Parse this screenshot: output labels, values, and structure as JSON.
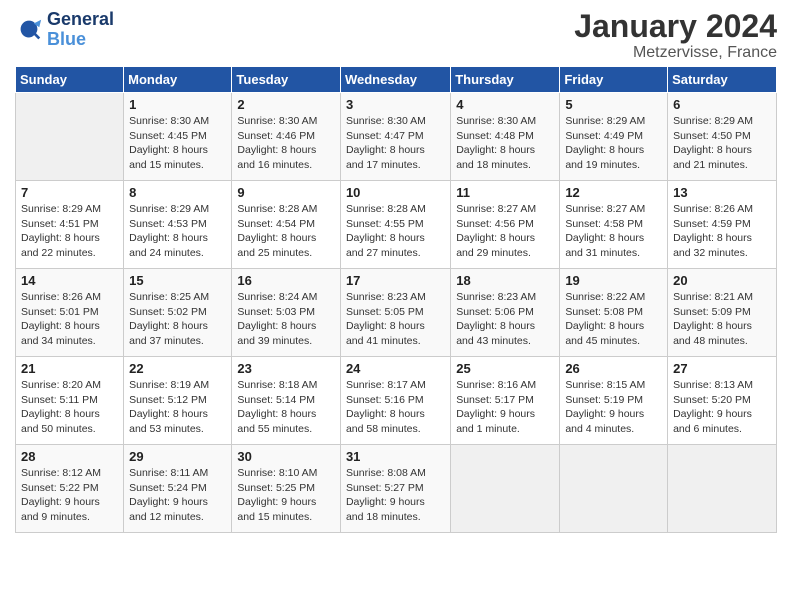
{
  "logo": {
    "line1": "General",
    "line2": "Blue"
  },
  "title": "January 2024",
  "location": "Metzervisse, France",
  "days_of_week": [
    "Sunday",
    "Monday",
    "Tuesday",
    "Wednesday",
    "Thursday",
    "Friday",
    "Saturday"
  ],
  "weeks": [
    [
      {
        "day": "",
        "info": ""
      },
      {
        "day": "1",
        "info": "Sunrise: 8:30 AM\nSunset: 4:45 PM\nDaylight: 8 hours\nand 15 minutes."
      },
      {
        "day": "2",
        "info": "Sunrise: 8:30 AM\nSunset: 4:46 PM\nDaylight: 8 hours\nand 16 minutes."
      },
      {
        "day": "3",
        "info": "Sunrise: 8:30 AM\nSunset: 4:47 PM\nDaylight: 8 hours\nand 17 minutes."
      },
      {
        "day": "4",
        "info": "Sunrise: 8:30 AM\nSunset: 4:48 PM\nDaylight: 8 hours\nand 18 minutes."
      },
      {
        "day": "5",
        "info": "Sunrise: 8:29 AM\nSunset: 4:49 PM\nDaylight: 8 hours\nand 19 minutes."
      },
      {
        "day": "6",
        "info": "Sunrise: 8:29 AM\nSunset: 4:50 PM\nDaylight: 8 hours\nand 21 minutes."
      }
    ],
    [
      {
        "day": "7",
        "info": ""
      },
      {
        "day": "8",
        "info": "Sunrise: 8:29 AM\nSunset: 4:53 PM\nDaylight: 8 hours\nand 24 minutes."
      },
      {
        "day": "9",
        "info": "Sunrise: 8:28 AM\nSunset: 4:54 PM\nDaylight: 8 hours\nand 25 minutes."
      },
      {
        "day": "10",
        "info": "Sunrise: 8:28 AM\nSunset: 4:55 PM\nDaylight: 8 hours\nand 27 minutes."
      },
      {
        "day": "11",
        "info": "Sunrise: 8:27 AM\nSunset: 4:56 PM\nDaylight: 8 hours\nand 29 minutes."
      },
      {
        "day": "12",
        "info": "Sunrise: 8:27 AM\nSunset: 4:58 PM\nDaylight: 8 hours\nand 31 minutes."
      },
      {
        "day": "13",
        "info": "Sunrise: 8:26 AM\nSunset: 4:59 PM\nDaylight: 8 hours\nand 32 minutes."
      }
    ],
    [
      {
        "day": "14",
        "info": ""
      },
      {
        "day": "15",
        "info": "Sunrise: 8:25 AM\nSunset: 5:02 PM\nDaylight: 8 hours\nand 37 minutes."
      },
      {
        "day": "16",
        "info": "Sunrise: 8:24 AM\nSunset: 5:03 PM\nDaylight: 8 hours\nand 39 minutes."
      },
      {
        "day": "17",
        "info": "Sunrise: 8:23 AM\nSunset: 5:05 PM\nDaylight: 8 hours\nand 41 minutes."
      },
      {
        "day": "18",
        "info": "Sunrise: 8:23 AM\nSunset: 5:06 PM\nDaylight: 8 hours\nand 43 minutes."
      },
      {
        "day": "19",
        "info": "Sunrise: 8:22 AM\nSunset: 5:08 PM\nDaylight: 8 hours\nand 45 minutes."
      },
      {
        "day": "20",
        "info": "Sunrise: 8:21 AM\nSunset: 5:09 PM\nDaylight: 8 hours\nand 48 minutes."
      }
    ],
    [
      {
        "day": "21",
        "info": ""
      },
      {
        "day": "22",
        "info": "Sunrise: 8:19 AM\nSunset: 5:12 PM\nDaylight: 8 hours\nand 53 minutes."
      },
      {
        "day": "23",
        "info": "Sunrise: 8:18 AM\nSunset: 5:14 PM\nDaylight: 8 hours\nand 55 minutes."
      },
      {
        "day": "24",
        "info": "Sunrise: 8:17 AM\nSunset: 5:16 PM\nDaylight: 8 hours\nand 58 minutes."
      },
      {
        "day": "25",
        "info": "Sunrise: 8:16 AM\nSunset: 5:17 PM\nDaylight: 9 hours\nand 1 minute."
      },
      {
        "day": "26",
        "info": "Sunrise: 8:15 AM\nSunset: 5:19 PM\nDaylight: 9 hours\nand 4 minutes."
      },
      {
        "day": "27",
        "info": "Sunrise: 8:13 AM\nSunset: 5:20 PM\nDaylight: 9 hours\nand 6 minutes."
      }
    ],
    [
      {
        "day": "28",
        "info": ""
      },
      {
        "day": "29",
        "info": "Sunrise: 8:11 AM\nSunset: 5:24 PM\nDaylight: 9 hours\nand 12 minutes."
      },
      {
        "day": "30",
        "info": "Sunrise: 8:10 AM\nSunset: 5:25 PM\nDaylight: 9 hours\nand 15 minutes."
      },
      {
        "day": "31",
        "info": "Sunrise: 8:08 AM\nSunset: 5:27 PM\nDaylight: 9 hours\nand 18 minutes."
      },
      {
        "day": "",
        "info": ""
      },
      {
        "day": "",
        "info": ""
      },
      {
        "day": "",
        "info": ""
      }
    ]
  ],
  "week1_sun_info": "Sunrise: 8:29 AM\nSunset: 4:51 PM\nDaylight: 8 hours\nand 22 minutes.",
  "week2_sun_info": "Sunrise: 8:26 AM\nSunset: 5:01 PM\nDaylight: 8 hours\nand 34 minutes.",
  "week3_sun_info": "Sunrise: 8:20 AM\nSunset: 5:11 PM\nDaylight: 8 hours\nand 50 minutes.",
  "week4_sun_info": "Sunrise: 8:12 AM\nSunset: 5:22 PM\nDaylight: 9 hours\nand 9 minutes."
}
